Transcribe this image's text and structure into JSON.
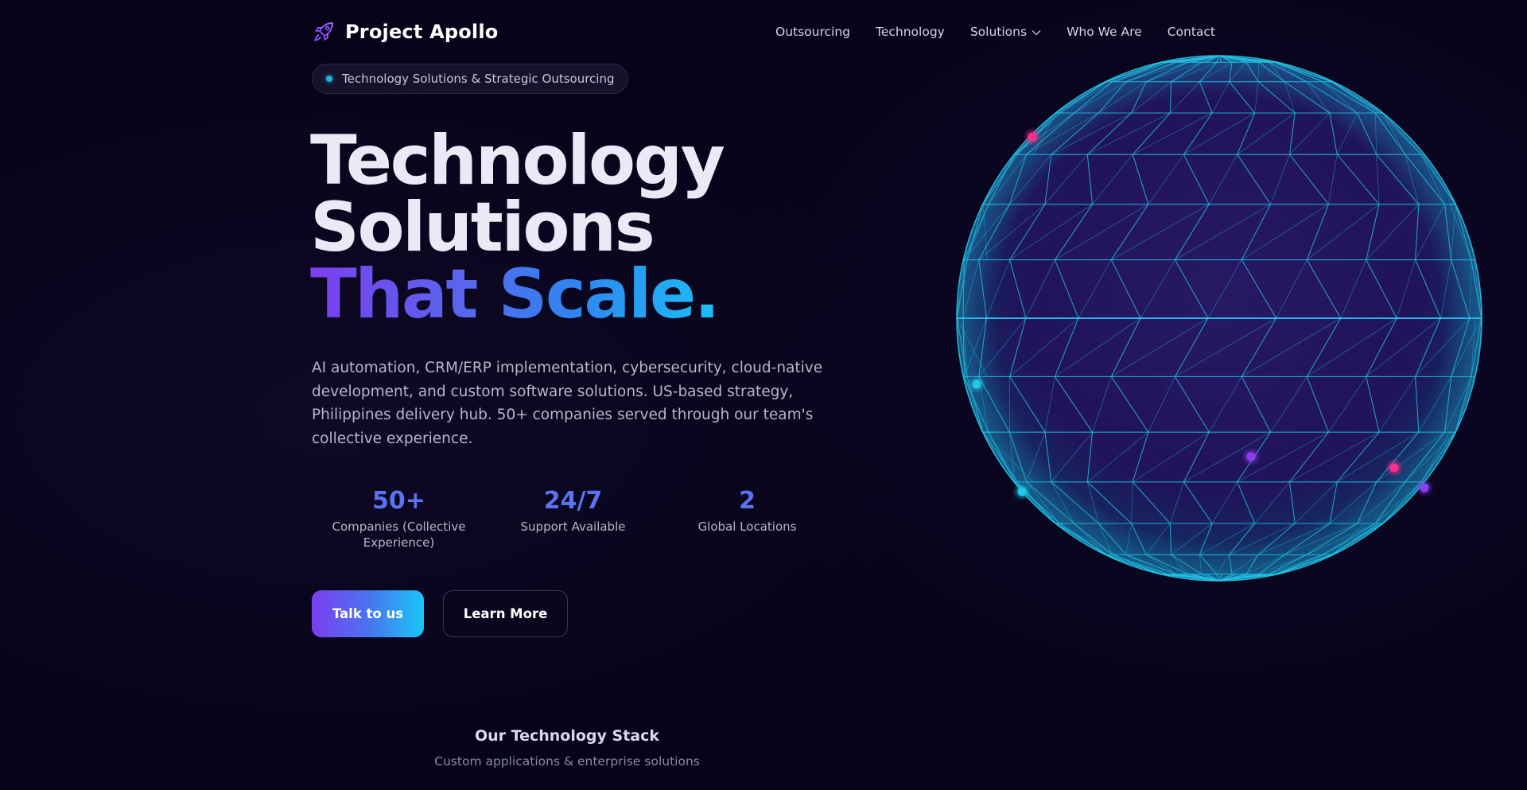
{
  "nav": {
    "brand": "Project Apollo",
    "links": [
      {
        "label": "Outsourcing"
      },
      {
        "label": "Technology"
      },
      {
        "label": "Solutions",
        "has_dropdown": true
      },
      {
        "label": "Who We Are"
      },
      {
        "label": "Contact"
      }
    ]
  },
  "hero": {
    "badge": "Technology Solutions & Strategic Outsourcing",
    "headline": {
      "line1": "Technology",
      "line2": "Solutions",
      "line3": "That Scale."
    },
    "description": "AI automation, CRM/ERP implementation, cybersecurity, cloud-native development, and custom software solutions. US-based strategy, Philippines delivery hub. 50+ companies served through our team's collective experience.",
    "stats": [
      {
        "value": "50+",
        "label": "Companies (Collective Experience)"
      },
      {
        "value": "24/7",
        "label": "Support Available"
      },
      {
        "value": "2",
        "label": "Global Locations"
      }
    ],
    "primary_button": "Talk to us",
    "secondary_button": "Learn More"
  },
  "stack": {
    "title": "Our Technology Stack",
    "subtitle": "Custom applications & enterprise solutions"
  },
  "colors": {
    "background": "#07041a",
    "accent_purple": "#7b3ff0",
    "accent_blue": "#5b73ee",
    "accent_cyan": "#19c6f6",
    "globe_wire": "#22c8e8",
    "marker_pink": "#ff2d8a"
  },
  "icons": {
    "brand": "rocket-icon",
    "dropdown": "chevron-down-icon",
    "badge": "status-dot-icon",
    "hero_visual": "wireframe-globe"
  }
}
